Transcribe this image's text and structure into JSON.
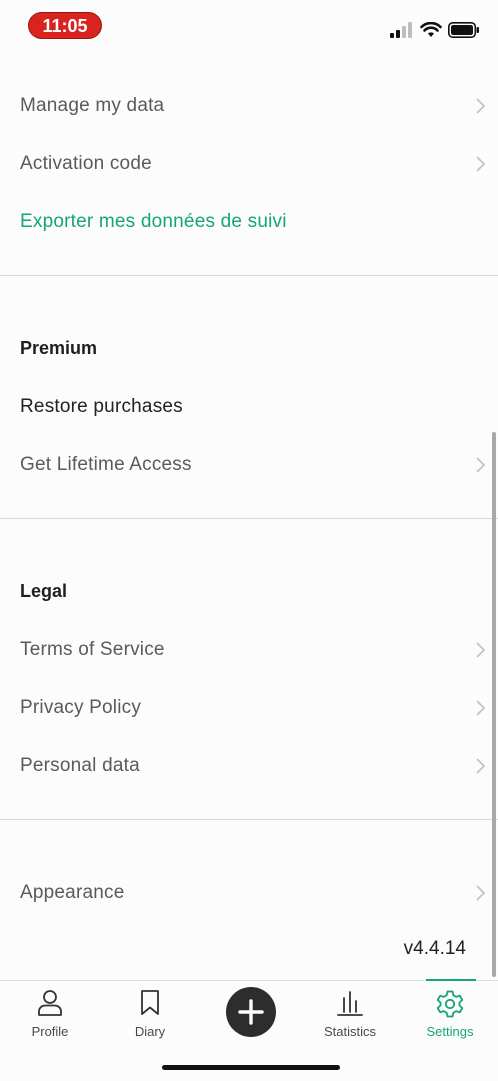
{
  "status_bar": {
    "time": "11:05"
  },
  "account": {
    "items": [
      {
        "label": "Manage my data"
      },
      {
        "label": "Activation code"
      },
      {
        "label": "Exporter mes données de suivi"
      }
    ]
  },
  "premium": {
    "title": "Premium",
    "items": [
      {
        "label": "Restore purchases"
      },
      {
        "label": "Get Lifetime Access"
      }
    ]
  },
  "legal": {
    "title": "Legal",
    "items": [
      {
        "label": "Terms of Service"
      },
      {
        "label": "Privacy Policy"
      },
      {
        "label": "Personal data"
      }
    ]
  },
  "other": {
    "items": [
      {
        "label": "Appearance"
      }
    ]
  },
  "version": "v4.4.14",
  "tabbar": {
    "tabs": [
      {
        "label": "Profile",
        "icon": "person-icon"
      },
      {
        "label": "Diary",
        "icon": "bookmark-icon"
      },
      {
        "label": "",
        "icon": "plus-icon"
      },
      {
        "label": "Statistics",
        "icon": "bar-chart-icon"
      },
      {
        "label": "Settings",
        "icon": "gear-icon"
      }
    ],
    "active": "Settings"
  },
  "colors": {
    "accent": "#16a47a",
    "time_pill": "#d8231f"
  }
}
